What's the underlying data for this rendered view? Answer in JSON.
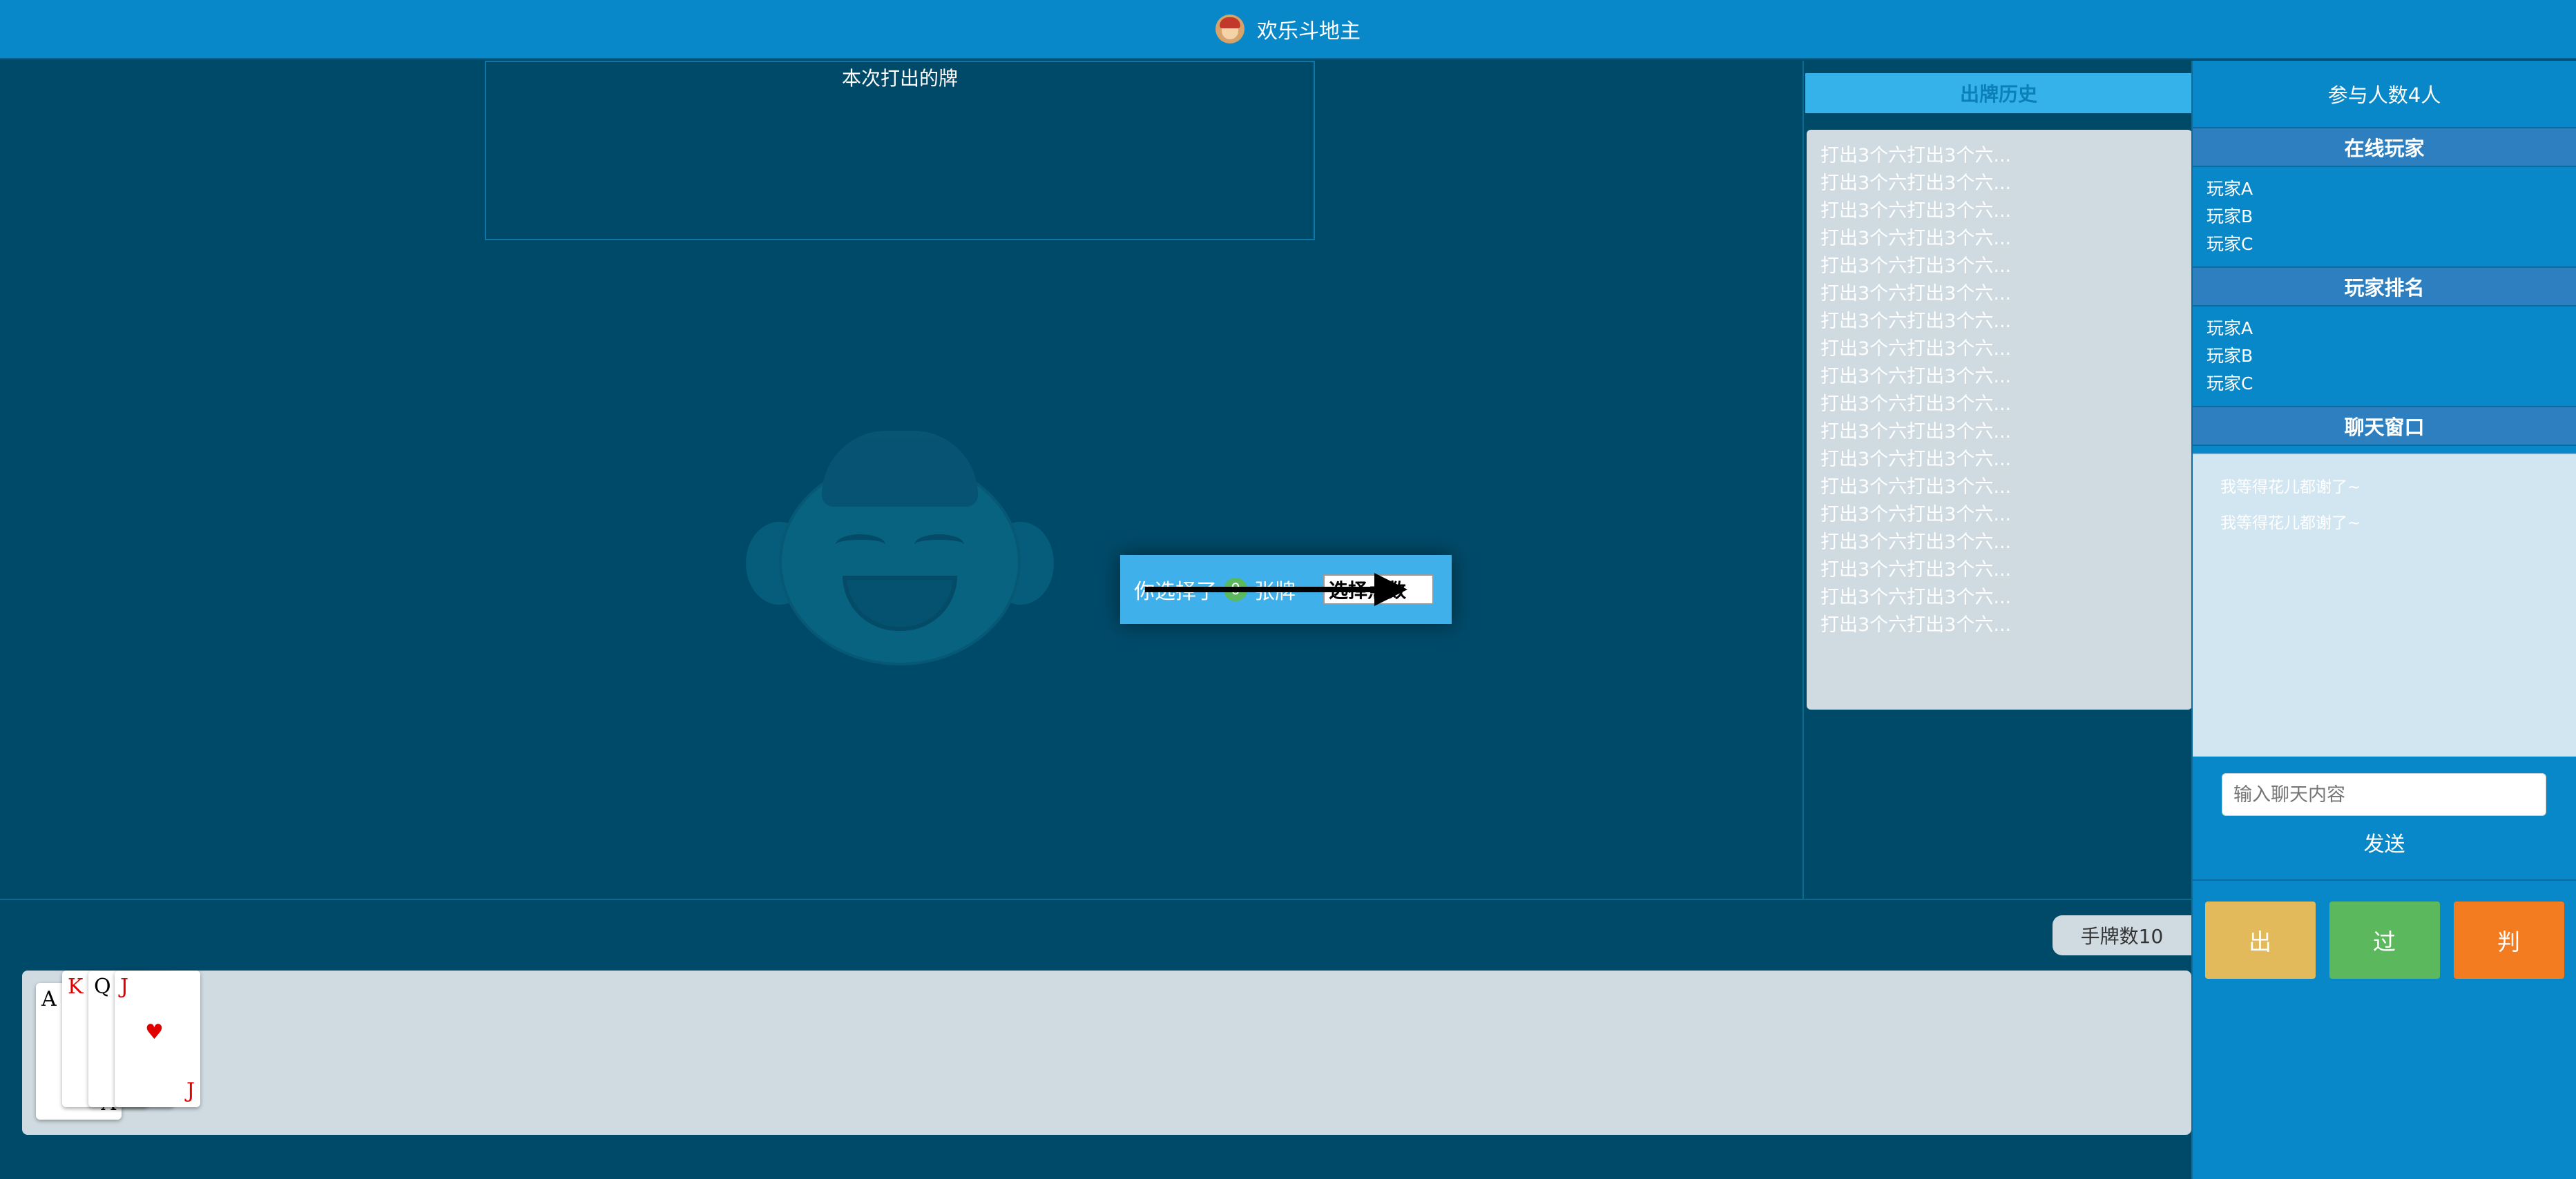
{
  "app": {
    "title": "欢乐斗地主"
  },
  "table": {
    "played_caption": "本次打出的牌",
    "selection": {
      "prefix": "你选择了",
      "count": "0",
      "suffix": "张牌",
      "select_button": "选择点数"
    },
    "hand_count": "手牌数10"
  },
  "hand_cards": [
    {
      "rank": "A",
      "suit": "",
      "color": "#000000"
    },
    {
      "rank": "K",
      "suit": "",
      "color": "#e00000"
    },
    {
      "rank": "Q",
      "suit": "",
      "color": "#000000"
    },
    {
      "rank": "J",
      "suit": "♥",
      "color": "#e00000"
    }
  ],
  "history": {
    "title": "出牌历史",
    "entries": [
      "打出3个六打出3个六...",
      "打出3个六打出3个六...",
      "打出3个六打出3个六...",
      "打出3个六打出3个六...",
      "打出3个六打出3个六...",
      "打出3个六打出3个六...",
      "打出3个六打出3个六...",
      "打出3个六打出3个六...",
      "打出3个六打出3个六...",
      "打出3个六打出3个六...",
      "打出3个六打出3个六...",
      "打出3个六打出3个六...",
      "打出3个六打出3个六...",
      "打出3个六打出3个六...",
      "打出3个六打出3个六...",
      "打出3个六打出3个六...",
      "打出3个六打出3个六...",
      "打出3个六打出3个六..."
    ]
  },
  "sidebar": {
    "players_count": "参与人数4人",
    "online_title": "在线玩家",
    "online_players": [
      "玩家A",
      "玩家B",
      "玩家C"
    ],
    "ranking_title": "玩家排名",
    "ranking": [
      "玩家A",
      "玩家B",
      "玩家C"
    ],
    "chat_title": "聊天窗口",
    "chat_messages": [
      "我等得花儿都谢了~",
      "我等得花儿都谢了~"
    ],
    "chat_placeholder": "输入聊天内容",
    "send_label": "发送",
    "actions": {
      "play": "出",
      "pass": "过",
      "judge": "判"
    }
  },
  "colors": {
    "brand": "#0888c8",
    "table_bg": "#004a69",
    "play": "#e2b95b",
    "pass": "#5cb85c",
    "judge": "#f47c20"
  }
}
